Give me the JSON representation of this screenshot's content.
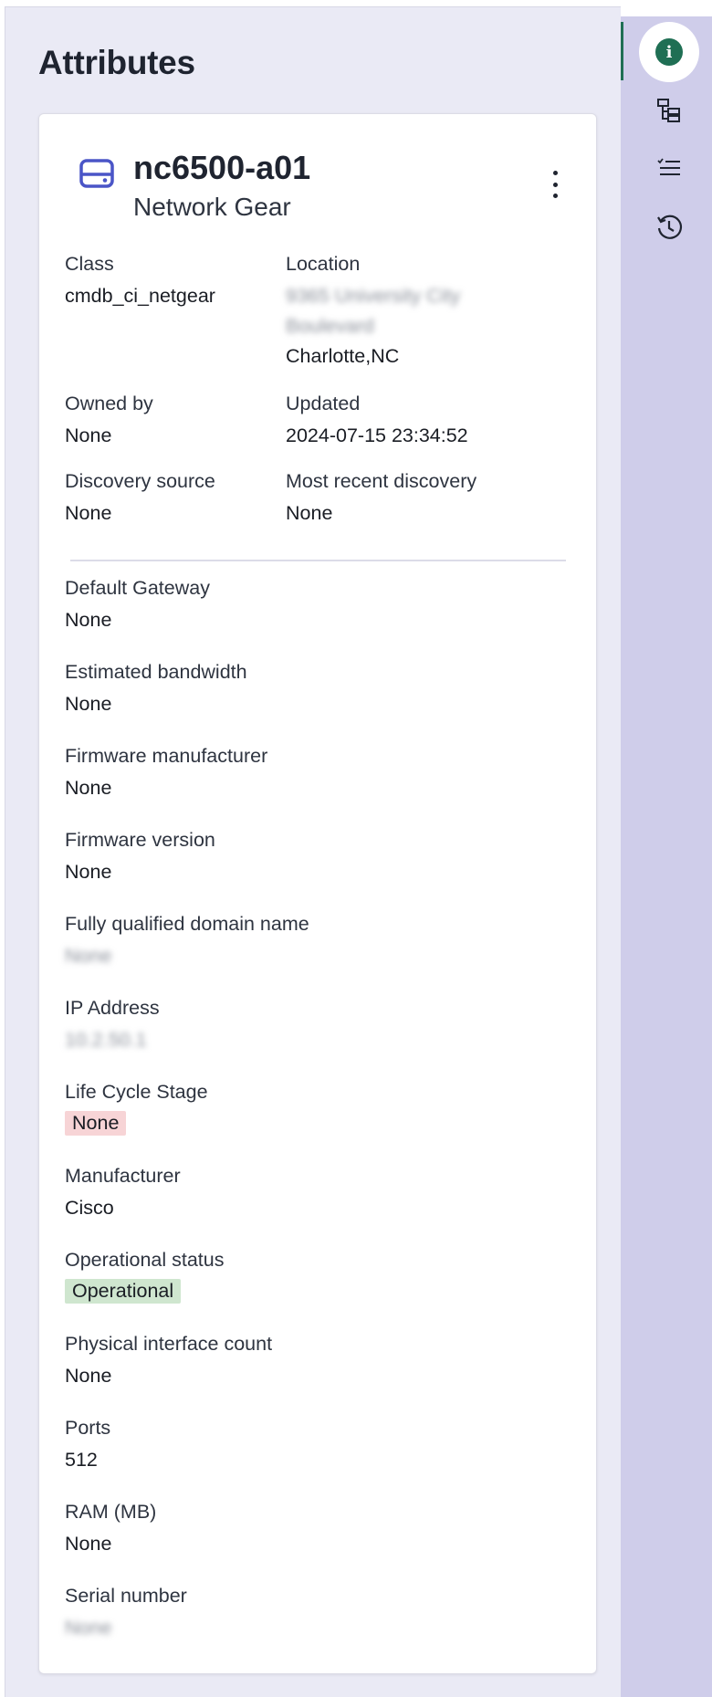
{
  "panel": {
    "title": "Attributes"
  },
  "ci": {
    "name": "nc6500-a01",
    "type": "Network Gear",
    "icon": "server-icon"
  },
  "summary": {
    "class": {
      "label": "Class",
      "value": "cmdb_ci_netgear"
    },
    "location": {
      "label": "Location",
      "value_blurred_1": "9365 University City",
      "value_blurred_2": "Boulevard",
      "value_city": "Charlotte,NC"
    },
    "owned_by": {
      "label": "Owned by",
      "value": "None"
    },
    "updated": {
      "label": "Updated",
      "value": "2024-07-15 23:34:52"
    },
    "discovery_source": {
      "label": "Discovery source",
      "value": "None"
    },
    "most_recent_discovery": {
      "label": "Most recent discovery",
      "value": "None"
    }
  },
  "attributes": {
    "default_gateway": {
      "label": "Default Gateway",
      "value": "None"
    },
    "estimated_bandwidth": {
      "label": "Estimated bandwidth",
      "value": "None"
    },
    "firmware_manufacturer": {
      "label": "Firmware manufacturer",
      "value": "None"
    },
    "firmware_version": {
      "label": "Firmware version",
      "value": "None"
    },
    "fqdn": {
      "label": "Fully qualified domain name",
      "value": "None"
    },
    "ip_address": {
      "label": "IP Address",
      "value": "10.2.50.1"
    },
    "life_cycle_stage": {
      "label": "Life Cycle Stage",
      "value": "None"
    },
    "manufacturer": {
      "label": "Manufacturer",
      "value": "Cisco"
    },
    "operational_status": {
      "label": "Operational status",
      "value": "Operational"
    },
    "physical_interface_count": {
      "label": "Physical interface count",
      "value": "None"
    },
    "ports": {
      "label": "Ports",
      "value": "512"
    },
    "ram": {
      "label": "RAM (MB)",
      "value": "None"
    },
    "serial_number": {
      "label": "Serial number",
      "value": "None"
    }
  },
  "rail": {
    "items": [
      {
        "icon": "info-icon",
        "glyph": "i",
        "active": true
      },
      {
        "icon": "hierarchy-icon"
      },
      {
        "icon": "checklist-icon"
      },
      {
        "icon": "history-icon"
      }
    ]
  },
  "colors": {
    "accent": "#1f6f54",
    "rail_bg": "#cfcdea",
    "panel_bg": "#eaeaf5",
    "ci_icon": "#4a55c7",
    "badge_red": "#f7d4d6",
    "badge_green": "#cfe6cf"
  }
}
